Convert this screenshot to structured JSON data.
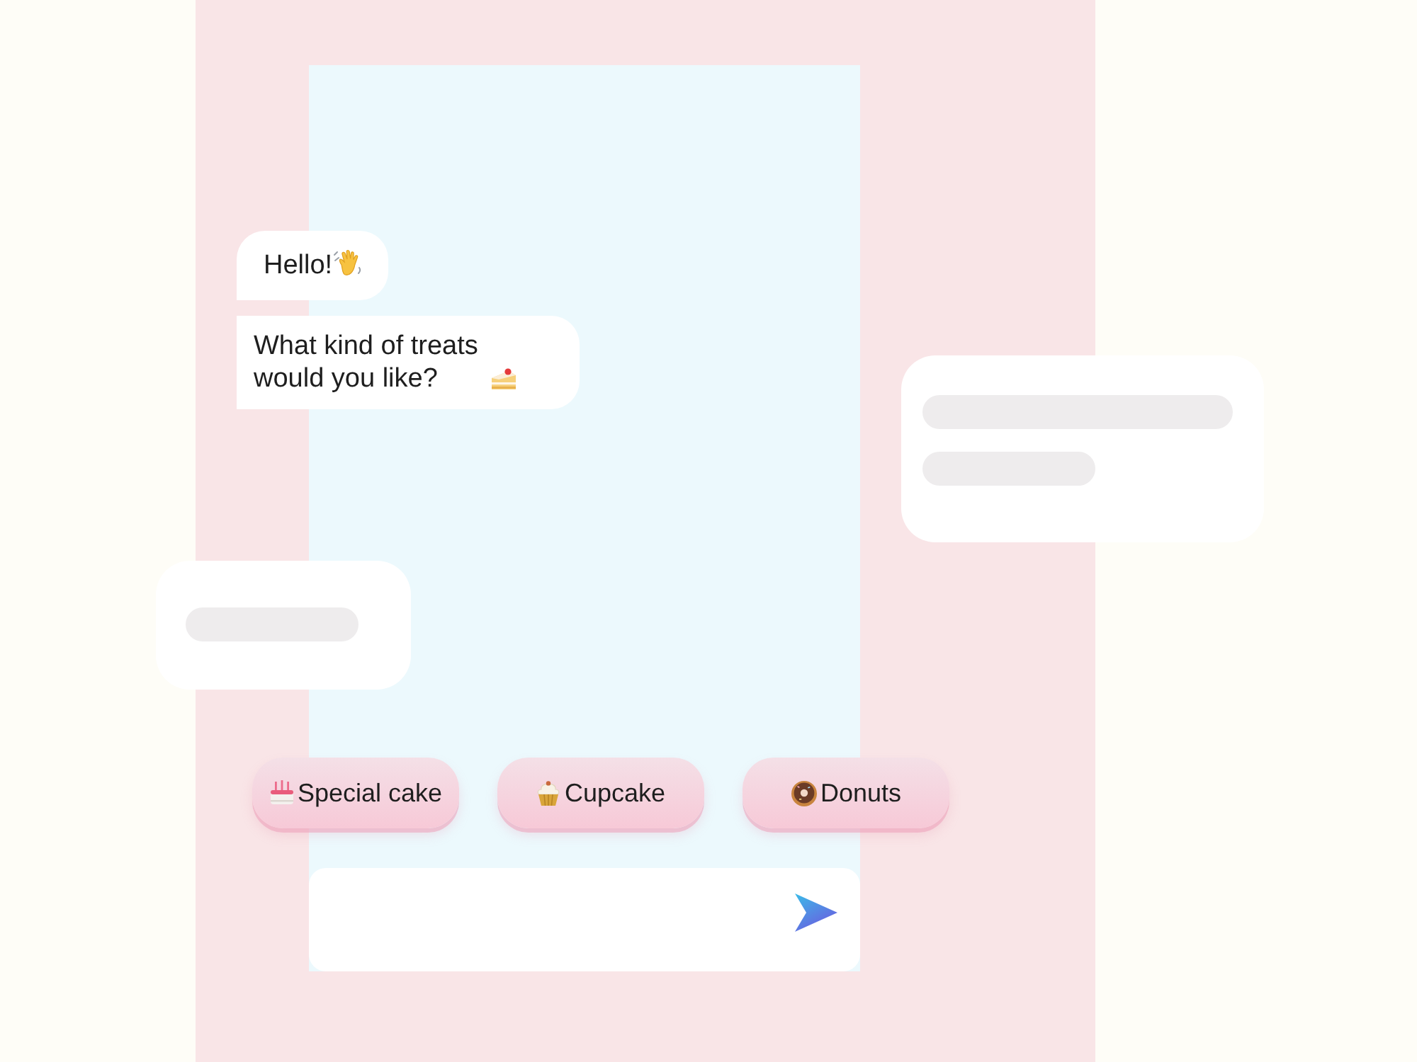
{
  "messages": [
    {
      "kind": "wave",
      "text": "Hello!"
    },
    {
      "kind": "cakeslice",
      "text": "What kind of treats would you like?"
    }
  ],
  "quick_replies": [
    {
      "kind": "cake",
      "label": "Special cake"
    },
    {
      "kind": "cupcake",
      "label": "Cupcake"
    },
    {
      "kind": "donut",
      "label": "Donuts"
    }
  ]
}
